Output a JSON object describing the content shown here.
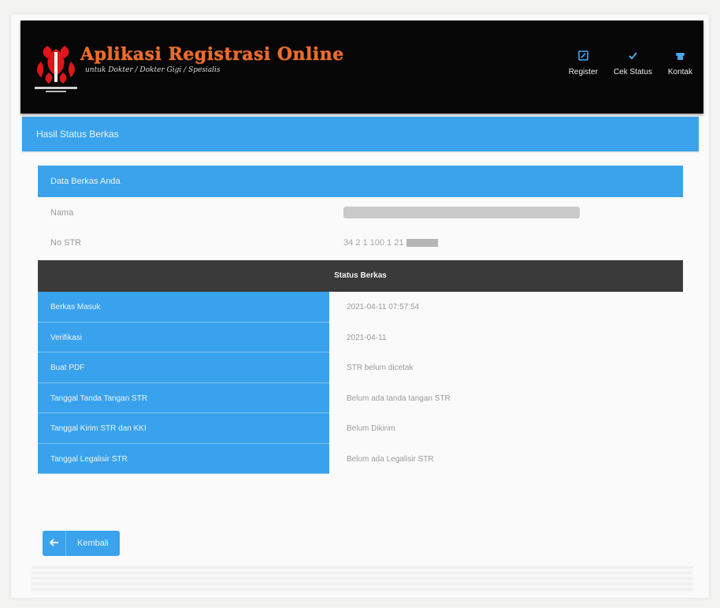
{
  "header": {
    "title": "Aplikasi Registrasi Online",
    "subtitle": "untuk Dokter / Dokter Gigi / Spesialis",
    "nav": [
      {
        "label": "Register",
        "icon": "edit-icon"
      },
      {
        "label": "Cek Status",
        "icon": "check-icon"
      },
      {
        "label": "Kontak",
        "icon": "phone-icon"
      }
    ]
  },
  "page": {
    "heading": "Hasil Status Berkas"
  },
  "card": {
    "heading": "Data Berkas Anda",
    "name_label": "Nama",
    "str_label": "No STR",
    "str_value": "34 2 1 100 1 21"
  },
  "status": {
    "heading": "Status Berkas",
    "rows": [
      {
        "label": "Berkas Masuk",
        "value": "2021-04-11 07:57:54"
      },
      {
        "label": "Verifikasi",
        "value": "2021-04-11"
      },
      {
        "label": "Buat PDF",
        "value": "STR belum dicetak"
      },
      {
        "label": "Tanggal Tanda Tangan STR",
        "value": "Belum ada tanda tangan STR"
      },
      {
        "label": "Tanggal Kirim STR dan KKI",
        "value": "Belum Dikirim"
      },
      {
        "label": "Tanggal Legalisir STR",
        "value": "Belum ada Legalisir STR"
      }
    ]
  },
  "footer": {
    "back_label": "Kembali"
  },
  "colors": {
    "accent": "#3aa3ec",
    "navbar": "#060606",
    "brand": "#f26b2a"
  }
}
